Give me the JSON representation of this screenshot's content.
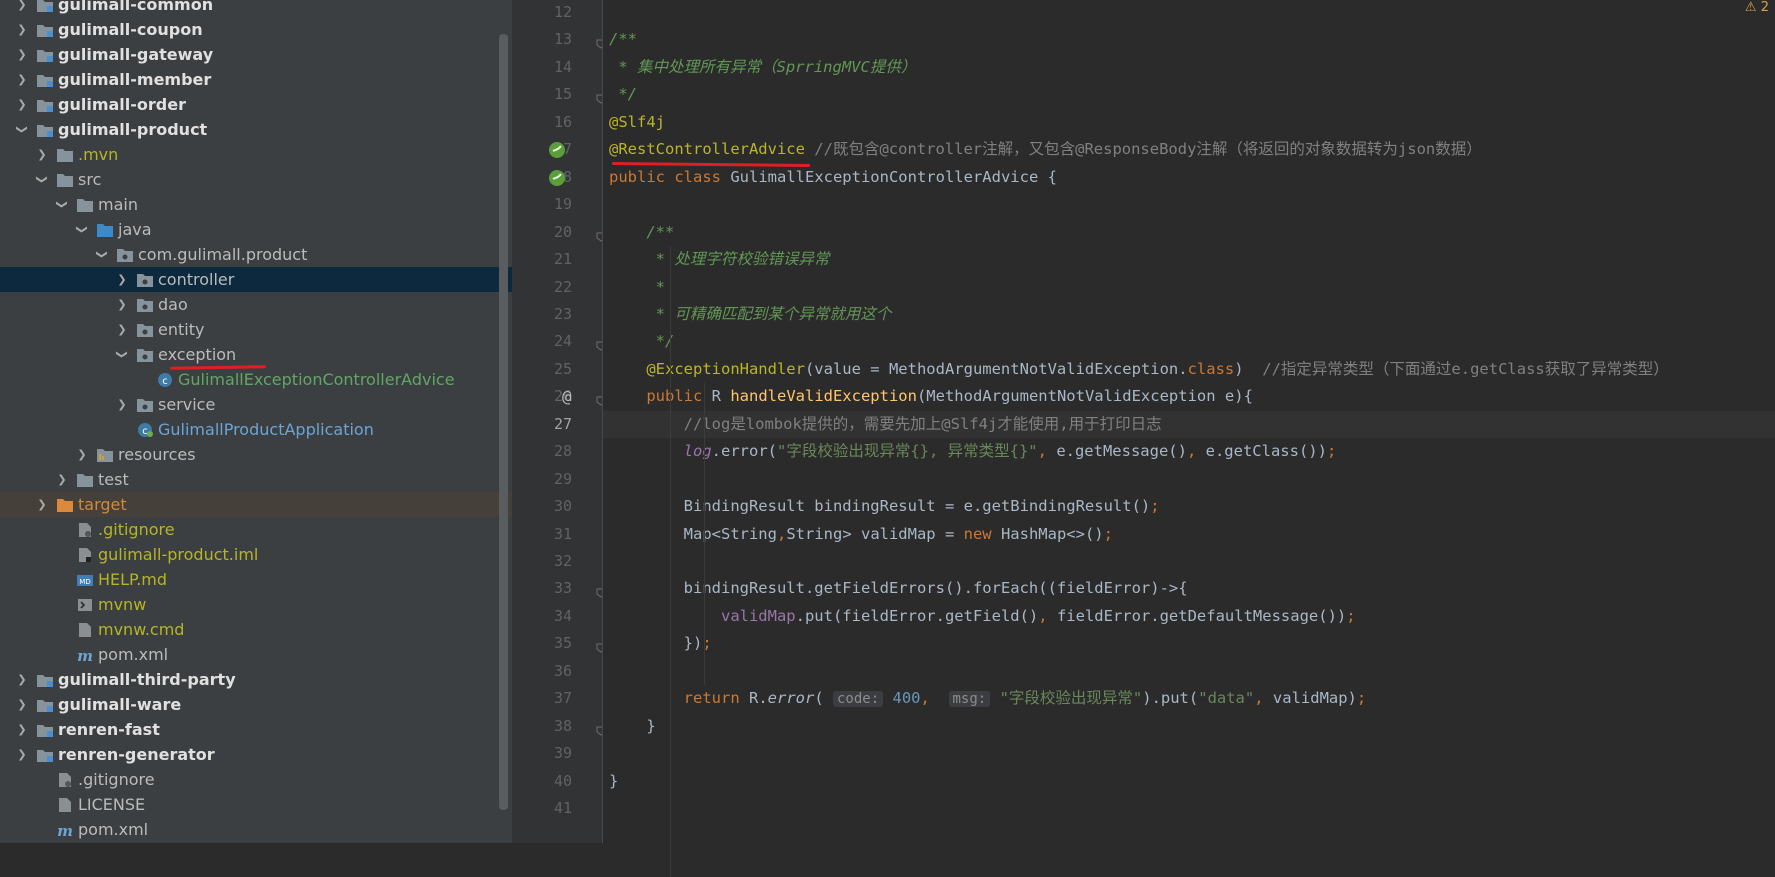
{
  "project_tree": {
    "items": [
      {
        "label": "gulimall-common",
        "depth": 0,
        "arrow": "right",
        "icon": "module",
        "bold": true,
        "style": "normal"
      },
      {
        "label": "gulimall-coupon",
        "depth": 0,
        "arrow": "right",
        "icon": "module",
        "bold": true,
        "style": "normal"
      },
      {
        "label": "gulimall-gateway",
        "depth": 0,
        "arrow": "right",
        "icon": "module",
        "bold": true,
        "style": "normal"
      },
      {
        "label": "gulimall-member",
        "depth": 0,
        "arrow": "right",
        "icon": "module",
        "bold": true,
        "style": "normal"
      },
      {
        "label": "gulimall-order",
        "depth": 0,
        "arrow": "right",
        "icon": "module",
        "bold": true,
        "style": "normal"
      },
      {
        "label": "gulimall-product",
        "depth": 0,
        "arrow": "down",
        "icon": "module",
        "bold": true,
        "style": "normal"
      },
      {
        "label": ".mvn",
        "depth": 1,
        "arrow": "right",
        "icon": "folder",
        "bold": false,
        "style": "olive"
      },
      {
        "label": "src",
        "depth": 1,
        "arrow": "down",
        "icon": "folder",
        "bold": false,
        "style": "normal"
      },
      {
        "label": "main",
        "depth": 2,
        "arrow": "down",
        "icon": "folder",
        "bold": false,
        "style": "normal"
      },
      {
        "label": "java",
        "depth": 3,
        "arrow": "down",
        "icon": "folder-blue",
        "bold": false,
        "style": "normal"
      },
      {
        "label": "com.gulimall.product",
        "depth": 4,
        "arrow": "down",
        "icon": "package",
        "bold": false,
        "style": "normal"
      },
      {
        "label": "controller",
        "depth": 5,
        "arrow": "right",
        "icon": "package",
        "bold": false,
        "style": "selected"
      },
      {
        "label": "dao",
        "depth": 5,
        "arrow": "right",
        "icon": "package",
        "bold": false,
        "style": "normal"
      },
      {
        "label": "entity",
        "depth": 5,
        "arrow": "right",
        "icon": "package",
        "bold": false,
        "style": "normal"
      },
      {
        "label": "exception",
        "depth": 5,
        "arrow": "down",
        "icon": "package",
        "bold": false,
        "style": "normal"
      },
      {
        "label": "GulimallExceptionControllerAdvice",
        "depth": 6,
        "arrow": "none",
        "icon": "class",
        "bold": false,
        "style": "green"
      },
      {
        "label": "service",
        "depth": 5,
        "arrow": "right",
        "icon": "package",
        "bold": false,
        "style": "normal"
      },
      {
        "label": "GulimallProductApplication",
        "depth": 5,
        "arrow": "none",
        "icon": "spring-class",
        "bold": false,
        "style": "blue"
      },
      {
        "label": "resources",
        "depth": 3,
        "arrow": "right",
        "icon": "folder-res",
        "bold": false,
        "style": "normal"
      },
      {
        "label": "test",
        "depth": 2,
        "arrow": "right",
        "icon": "folder",
        "bold": false,
        "style": "normal"
      },
      {
        "label": "target",
        "depth": 1,
        "arrow": "right",
        "icon": "folder-orange",
        "bold": false,
        "style": "excluded"
      },
      {
        "label": ".gitignore",
        "depth": 2,
        "arrow": "none",
        "icon": "file-git",
        "bold": false,
        "style": "olive"
      },
      {
        "label": "gulimall-product.iml",
        "depth": 2,
        "arrow": "none",
        "icon": "file-iml",
        "bold": false,
        "style": "olive"
      },
      {
        "label": "HELP.md",
        "depth": 2,
        "arrow": "none",
        "icon": "file-md",
        "bold": false,
        "style": "olive"
      },
      {
        "label": "mvnw",
        "depth": 2,
        "arrow": "none",
        "icon": "file-exec",
        "bold": false,
        "style": "olive"
      },
      {
        "label": "mvnw.cmd",
        "depth": 2,
        "arrow": "none",
        "icon": "file",
        "bold": false,
        "style": "olive"
      },
      {
        "label": "pom.xml",
        "depth": 2,
        "arrow": "none",
        "icon": "maven",
        "bold": false,
        "style": "normal"
      },
      {
        "label": "gulimall-third-party",
        "depth": 0,
        "arrow": "right",
        "icon": "module",
        "bold": true,
        "style": "normal"
      },
      {
        "label": "gulimall-ware",
        "depth": 0,
        "arrow": "right",
        "icon": "module",
        "bold": true,
        "style": "normal"
      },
      {
        "label": "renren-fast",
        "depth": 0,
        "arrow": "right",
        "icon": "module",
        "bold": true,
        "style": "normal"
      },
      {
        "label": "renren-generator",
        "depth": 0,
        "arrow": "right",
        "icon": "module",
        "bold": true,
        "style": "normal"
      },
      {
        "label": ".gitignore",
        "depth": 1,
        "arrow": "none",
        "icon": "file-git",
        "bold": false,
        "style": "normal"
      },
      {
        "label": "LICENSE",
        "depth": 1,
        "arrow": "none",
        "icon": "file",
        "bold": false,
        "style": "normal"
      },
      {
        "label": "pom.xml",
        "depth": 1,
        "arrow": "none",
        "icon": "maven",
        "bold": false,
        "style": "normal"
      }
    ]
  },
  "editor": {
    "warning_count": "2",
    "current_line": 27,
    "lines": [
      {
        "n": "12",
        "tokens": []
      },
      {
        "n": "13",
        "tokens": [
          {
            "t": "/**",
            "c": "doc"
          }
        ]
      },
      {
        "n": "14",
        "tokens": [
          {
            "t": " * 集中处理所有异常（",
            "c": "doc"
          },
          {
            "t": "SprringMVC",
            "c": "doc"
          },
          {
            "t": "提供）",
            "c": "doc"
          }
        ]
      },
      {
        "n": "15",
        "tokens": [
          {
            "t": " */",
            "c": "doc"
          }
        ]
      },
      {
        "n": "16",
        "tokens": [
          {
            "t": "@Slf4j",
            "c": "ann"
          }
        ]
      },
      {
        "n": "17",
        "tokens": [
          {
            "t": "@RestControllerAdvice",
            "c": "ann"
          },
          {
            "t": " //既包含@controller注解，又包含@ResponseBody注解（将返回的对象数据转为json数据）",
            "c": "cm"
          }
        ]
      },
      {
        "n": "18",
        "tokens": [
          {
            "t": "public class ",
            "c": "kw"
          },
          {
            "t": "GulimallExceptionControllerAdvice",
            "c": "plain"
          },
          {
            "t": " {",
            "c": "plain"
          }
        ]
      },
      {
        "n": "19",
        "tokens": []
      },
      {
        "n": "20",
        "tokens": [
          {
            "t": "    /**",
            "c": "doc"
          }
        ]
      },
      {
        "n": "21",
        "tokens": [
          {
            "t": "     * 处理字符校验错误异常",
            "c": "doc"
          }
        ]
      },
      {
        "n": "22",
        "tokens": [
          {
            "t": "     *",
            "c": "doc"
          }
        ]
      },
      {
        "n": "23",
        "tokens": [
          {
            "t": "     * 可精确匹配到某个异常就用这个",
            "c": "doc"
          }
        ]
      },
      {
        "n": "24",
        "tokens": [
          {
            "t": "     */",
            "c": "doc"
          }
        ]
      },
      {
        "n": "25",
        "tokens": [
          {
            "t": "    @ExceptionHandler",
            "c": "ann"
          },
          {
            "t": "(value = MethodArgumentNotValidException.",
            "c": "plain"
          },
          {
            "t": "class",
            "c": "kw"
          },
          {
            "t": ")  ",
            "c": "plain"
          },
          {
            "t": "//指定异常类型（下面通过e.getClass获取了异常类型）",
            "c": "cm"
          }
        ]
      },
      {
        "n": "26",
        "tokens": [
          {
            "t": "    public ",
            "c": "kw"
          },
          {
            "t": "R ",
            "c": "plain"
          },
          {
            "t": "handleValidException",
            "c": "fn"
          },
          {
            "t": "(MethodArgumentNotValidException e){",
            "c": "plain"
          }
        ]
      },
      {
        "n": "27",
        "tokens": [
          {
            "t": "        //log是lombok提供的，需要先加上@Slf4j才能使用,用于打印日志",
            "c": "cm"
          }
        ]
      },
      {
        "n": "28",
        "tokens": [
          {
            "t": "        ",
            "c": "plain"
          },
          {
            "t": "log",
            "c": "fldi"
          },
          {
            "t": ".error(",
            "c": "plain"
          },
          {
            "t": "\"字段校验出现异常{}, 异常类型{}\"",
            "c": "str"
          },
          {
            "t": ", ",
            "c": "kw"
          },
          {
            "t": "e.getMessage()",
            "c": "plain"
          },
          {
            "t": ", ",
            "c": "kw"
          },
          {
            "t": "e.getClass())",
            "c": "plain"
          },
          {
            "t": ";",
            "c": "kw"
          }
        ]
      },
      {
        "n": "29",
        "tokens": []
      },
      {
        "n": "30",
        "tokens": [
          {
            "t": "        BindingResult bindingResult = e.getBindingResult()",
            "c": "plain"
          },
          {
            "t": ";",
            "c": "kw"
          }
        ]
      },
      {
        "n": "31",
        "tokens": [
          {
            "t": "        Map<String",
            "c": "plain"
          },
          {
            "t": ",",
            "c": "kw"
          },
          {
            "t": "String> validMap = ",
            "c": "plain"
          },
          {
            "t": "new ",
            "c": "kw"
          },
          {
            "t": "HashMap<>()",
            "c": "plain"
          },
          {
            "t": ";",
            "c": "kw"
          }
        ]
      },
      {
        "n": "32",
        "tokens": []
      },
      {
        "n": "33",
        "tokens": [
          {
            "t": "        bindingResult.getFieldErrors().forEach((fieldError)->{",
            "c": "plain"
          }
        ]
      },
      {
        "n": "34",
        "tokens": [
          {
            "t": "            ",
            "c": "plain"
          },
          {
            "t": "validMap",
            "c": "fld"
          },
          {
            "t": ".put(fieldError.getField()",
            "c": "plain"
          },
          {
            "t": ", ",
            "c": "kw"
          },
          {
            "t": "fieldError.getDefaultMessage())",
            "c": "plain"
          },
          {
            "t": ";",
            "c": "kw"
          }
        ]
      },
      {
        "n": "35",
        "tokens": [
          {
            "t": "        })",
            "c": "plain"
          },
          {
            "t": ";",
            "c": "kw"
          }
        ]
      },
      {
        "n": "36",
        "tokens": []
      },
      {
        "n": "37",
        "tokens": [
          {
            "t": "        return ",
            "c": "kw"
          },
          {
            "t": "R.",
            "c": "plain"
          },
          {
            "t": "error",
            "c": "it"
          },
          {
            "t": "( ",
            "c": "plain"
          },
          {
            "t": "code:",
            "c": "hint"
          },
          {
            "t": " ",
            "c": "plain"
          },
          {
            "t": "400",
            "c": "num"
          },
          {
            "t": ",  ",
            "c": "kw"
          },
          {
            "t": "msg:",
            "c": "hint"
          },
          {
            "t": " ",
            "c": "plain"
          },
          {
            "t": "\"字段校验出现异常\"",
            "c": "str"
          },
          {
            "t": ").put(",
            "c": "plain"
          },
          {
            "t": "\"data\"",
            "c": "str"
          },
          {
            "t": ", ",
            "c": "kw"
          },
          {
            "t": "validMap)",
            "c": "plain"
          },
          {
            "t": ";",
            "c": "kw"
          }
        ]
      },
      {
        "n": "38",
        "tokens": [
          {
            "t": "    }",
            "c": "plain"
          }
        ]
      },
      {
        "n": "39",
        "tokens": []
      },
      {
        "n": "40",
        "tokens": [
          {
            "t": "}",
            "c": "plain"
          }
        ]
      },
      {
        "n": "41",
        "tokens": []
      }
    ]
  }
}
